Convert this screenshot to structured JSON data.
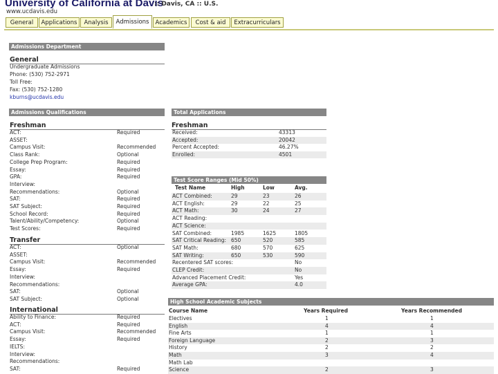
{
  "header": {
    "title": "University of California at Davis",
    "location": ":: Davis, CA :: U.S.",
    "url": "www.ucdavis.edu"
  },
  "tabs": [
    {
      "label": "General",
      "active": false
    },
    {
      "label": "Applications",
      "active": false
    },
    {
      "label": "Analysis",
      "active": false
    },
    {
      "label": "Admissions",
      "active": true
    },
    {
      "label": "Academics",
      "active": false
    },
    {
      "label": "Cost & aid",
      "active": false
    },
    {
      "label": "Extracurriculars",
      "active": false
    }
  ],
  "admissions_department": {
    "heading": "Admissions Department",
    "subheading": "General",
    "lines": [
      "Undergraduate Admissions",
      "Phone: (530) 752-2971",
      "Toll Free:",
      "Fax: (530) 752-1280",
      "kburns@ucdavis.edu"
    ]
  },
  "qualifications": {
    "heading": "Admissions Qualifications",
    "freshman": {
      "label": "Freshman",
      "rows": [
        [
          "ACT:",
          "Required"
        ],
        [
          "ASSET:",
          ""
        ],
        [
          "Campus Visit:",
          "Recommended"
        ],
        [
          "Class Rank:",
          "Optional"
        ],
        [
          "College Prep Program:",
          "Required"
        ],
        [
          "Essay:",
          "Required"
        ],
        [
          "GPA:",
          "Required"
        ],
        [
          "Interview:",
          ""
        ],
        [
          "Recommendations:",
          "Optional"
        ],
        [
          "SAT:",
          "Required"
        ],
        [
          "SAT Subject:",
          "Required"
        ],
        [
          "School Record:",
          "Required"
        ],
        [
          "Talent/Ability/Competency:",
          "Optional"
        ],
        [
          "Test Scores:",
          "Required"
        ]
      ]
    },
    "transfer": {
      "label": "Transfer",
      "rows": [
        [
          "ACT:",
          "Optional"
        ],
        [
          "ASSET:",
          ""
        ],
        [
          "Campus Visit:",
          "Recommended"
        ],
        [
          "Essay:",
          "Required"
        ],
        [
          "Interview:",
          ""
        ],
        [
          "Recommendations:",
          ""
        ],
        [
          "SAT:",
          "Optional"
        ],
        [
          "SAT Subject:",
          "Optional"
        ]
      ]
    },
    "international": {
      "label": "International",
      "rows": [
        [
          "Ability to Finance:",
          "Required"
        ],
        [
          "ACT:",
          "Required"
        ],
        [
          "Campus Visit:",
          "Recommended"
        ],
        [
          "Essay:",
          "Required"
        ],
        [
          "IELTS:",
          ""
        ],
        [
          "Interview:",
          ""
        ],
        [
          "Recommendations:",
          ""
        ],
        [
          "SAT:",
          "Required"
        ]
      ]
    }
  },
  "total_applications": {
    "heading": "Total Applications",
    "subheading": "Freshman",
    "rows": [
      [
        "Received:",
        "43313"
      ],
      [
        "Accepted:",
        "20042"
      ],
      [
        "Percent Accepted:",
        "46.27%"
      ],
      [
        "Enrolled:",
        "4501"
      ]
    ]
  },
  "test_scores": {
    "heading": "Test Score Ranges (Mid 50%)",
    "columns": [
      "Test Name",
      "High",
      "Low",
      "Avg."
    ],
    "rows": [
      [
        "ACT Combined:",
        "29",
        "23",
        "26"
      ],
      [
        "ACT English:",
        "29",
        "22",
        "25"
      ],
      [
        "ACT Math:",
        "30",
        "24",
        "27"
      ],
      [
        "ACT Reading:",
        "",
        "",
        ""
      ],
      [
        "ACT Science:",
        "",
        "",
        ""
      ],
      [
        "SAT Combined:",
        "1985",
        "1625",
        "1805"
      ],
      [
        "SAT Critical Reading:",
        "650",
        "520",
        "585"
      ],
      [
        "SAT Math:",
        "680",
        "570",
        "625"
      ],
      [
        "SAT Writing:",
        "650",
        "530",
        "590"
      ],
      [
        "Recentered SAT scores:",
        "",
        "",
        "No"
      ],
      [
        "CLEP Credit:",
        "",
        "",
        "No"
      ],
      [
        "Advanced Placement Credit:",
        "",
        "",
        "Yes"
      ],
      [
        "Average GPA:",
        "",
        "",
        "4.0"
      ]
    ]
  },
  "hs_subjects": {
    "heading": "High School Academic Subjects",
    "columns": [
      "Course Name",
      "Years Required",
      "Years Recommended"
    ],
    "rows": [
      [
        "Electives",
        "1",
        "1"
      ],
      [
        "English",
        "4",
        "4"
      ],
      [
        "Fine Arts",
        "1",
        "1"
      ],
      [
        "Foreign Language",
        "2",
        "3"
      ],
      [
        "History",
        "2",
        "2"
      ],
      [
        "Math",
        "3",
        "4"
      ],
      [
        "Math Lab",
        "",
        ""
      ],
      [
        "Science",
        "2",
        "3"
      ]
    ]
  }
}
